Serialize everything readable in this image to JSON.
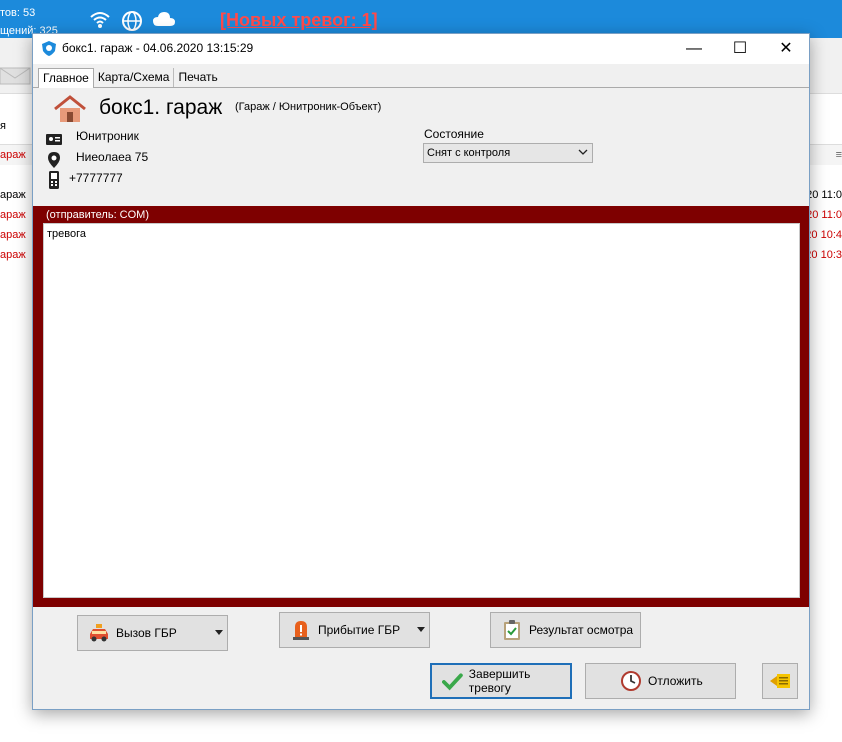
{
  "background": {
    "stats_line1": "тов: 53",
    "stats_line2": "щений: 325",
    "alert": "[Новых тревог: 1]",
    "rows": [
      {
        "left": "я",
        "right": "",
        "color": "#000000"
      },
      {
        "left": "араж",
        "right": "",
        "color": "#cc0000"
      },
      {
        "left": "араж",
        "right": "020 11:0",
        "color": "#000000"
      },
      {
        "left": "араж",
        "right": "20 11:0",
        "color": "#cc0000"
      },
      {
        "left": "араж",
        "right": "020 10:4",
        "color": "#cc0000"
      },
      {
        "left": "араж",
        "right": "20 10:3",
        "color": "#cc0000"
      }
    ]
  },
  "window": {
    "title": "бокс1. гараж - 04.06.2020 13:15:29",
    "minimize": "—",
    "maximize": "☐",
    "close": "✕"
  },
  "tabs": [
    {
      "label": "Главное",
      "active": true
    },
    {
      "label": "Карта/Схема",
      "active": false
    },
    {
      "label": "Печать",
      "active": false
    }
  ],
  "object": {
    "name": "бокс1. гараж",
    "subtitle": "(Гараж / Юнитроник-Объект)",
    "owner": "Юнитроник",
    "address": "Ниеолаеа 75",
    "phone": "+7777777"
  },
  "state": {
    "label": "Состояние",
    "value": "Снят с контроля"
  },
  "message": {
    "sender": "(отправитель: COM)",
    "text": "тревога"
  },
  "buttons": {
    "call_gbr": "Вызов ГБР",
    "arrival_gbr": "Прибытие ГБР",
    "inspection_result": "Результат осмотра",
    "finish_alarm": "Завершить тревогу",
    "postpone": "Отложить"
  },
  "colors": {
    "accent": "#1c8adb",
    "alarm_frame": "#7e0000",
    "alert_text": "#ff4a4a"
  }
}
